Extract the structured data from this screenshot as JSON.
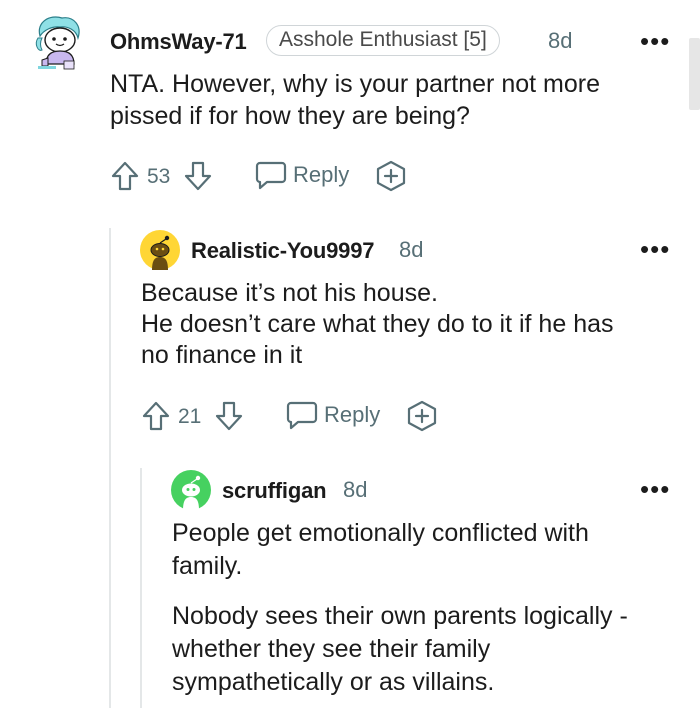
{
  "comments": [
    {
      "username": "OhmsWay-71",
      "flair": "Asshole Enthusiast [5]",
      "time": "8d",
      "body": [
        "NTA. However, why is your partner not more",
        "pissed if for how they are being?"
      ],
      "votes": "53",
      "reply_label": "Reply",
      "more_label": "•••"
    },
    {
      "username": "Realistic-You9997",
      "time": "8d",
      "body": [
        "Because it’s not his house.",
        "He doesn’t care what they do to it if he has",
        "no finance in it"
      ],
      "votes": "21",
      "reply_label": "Reply",
      "more_label": "•••"
    },
    {
      "username": "scruffigan",
      "time": "8d",
      "body": [
        "People get emotionally conflicted with",
        "family."
      ],
      "body2": [
        "Nobody sees their own parents logically -",
        "whether they see their family",
        "sympathetically or as villains."
      ],
      "more_label": "•••"
    }
  ],
  "colors": {
    "text": "#1c1c1c",
    "meta": "#576f76",
    "thread_line": "#e4e7e8",
    "avatar2_bg": "#ffd635",
    "avatar3_bg": "#46d160"
  },
  "icons": [
    "upvote-icon",
    "downvote-icon",
    "comment-bubble-icon",
    "award-icon",
    "more-options-icon"
  ]
}
